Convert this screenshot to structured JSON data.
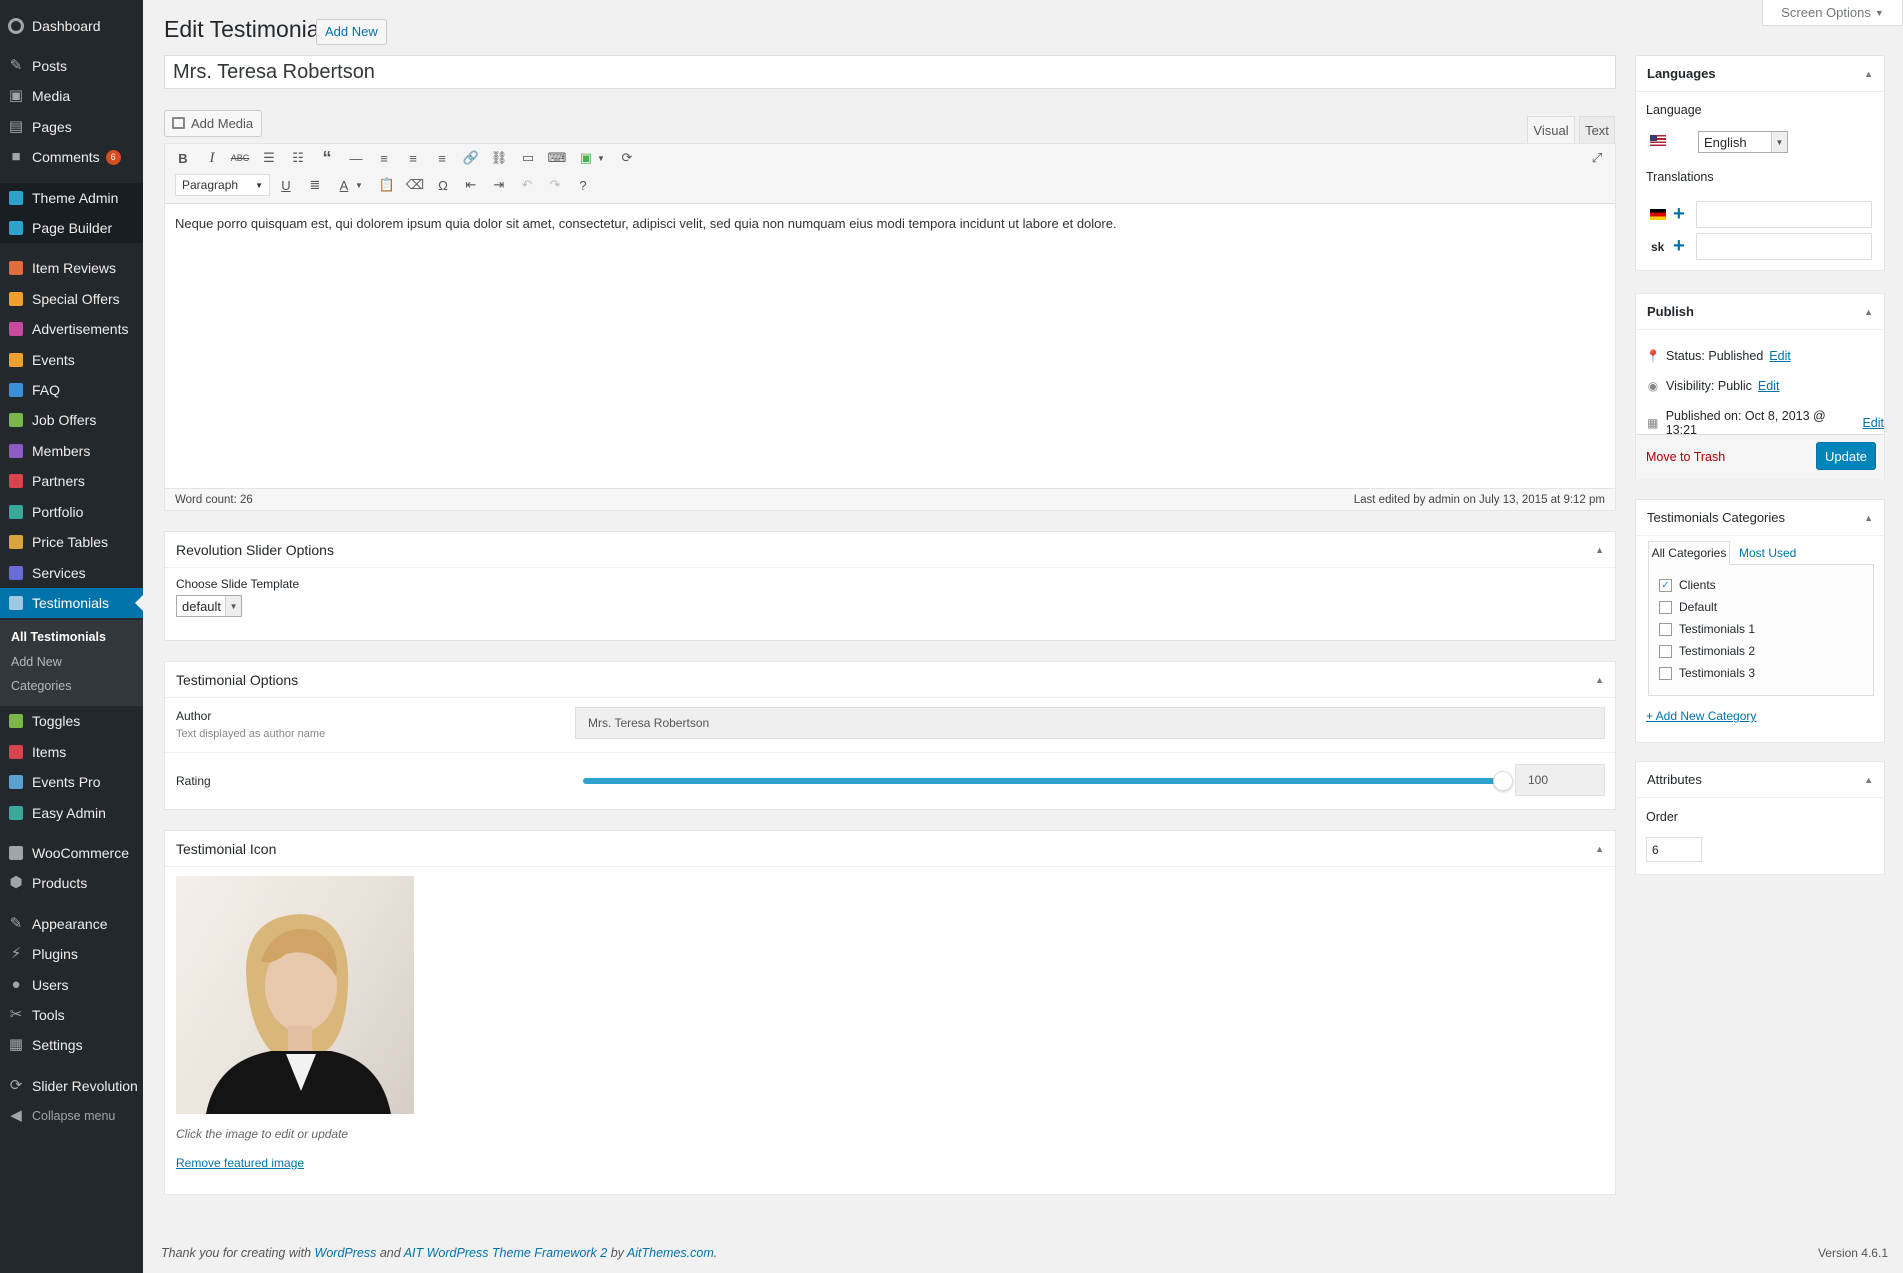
{
  "sidebar": {
    "items": [
      {
        "label": "Dashboard",
        "icon": "dashboard-icon"
      },
      {
        "label": "Posts",
        "icon": "pin-icon"
      },
      {
        "label": "Media",
        "icon": "media-icon"
      },
      {
        "label": "Pages",
        "icon": "pages-icon"
      },
      {
        "label": "Comments",
        "icon": "comment-icon",
        "badge": "6"
      },
      {
        "label": "Theme Admin",
        "icon": "theme-admin-icon"
      },
      {
        "label": "Page Builder",
        "icon": "page-builder-icon"
      },
      {
        "label": "Item Reviews",
        "icon": "item-reviews-icon"
      },
      {
        "label": "Special Offers",
        "icon": "special-offers-icon"
      },
      {
        "label": "Advertisements",
        "icon": "advertisements-icon"
      },
      {
        "label": "Events",
        "icon": "events-icon"
      },
      {
        "label": "FAQ",
        "icon": "faq-icon"
      },
      {
        "label": "Job Offers",
        "icon": "job-offers-icon"
      },
      {
        "label": "Members",
        "icon": "members-icon"
      },
      {
        "label": "Partners",
        "icon": "partners-icon"
      },
      {
        "label": "Portfolio",
        "icon": "portfolio-icon"
      },
      {
        "label": "Price Tables",
        "icon": "price-tables-icon"
      },
      {
        "label": "Services",
        "icon": "services-icon"
      },
      {
        "label": "Testimonials",
        "icon": "testimonials-icon"
      },
      {
        "label": "Toggles",
        "icon": "toggles-icon"
      },
      {
        "label": "Items",
        "icon": "items-icon"
      },
      {
        "label": "Events Pro",
        "icon": "events-pro-icon"
      },
      {
        "label": "Easy Admin",
        "icon": "easy-admin-icon"
      },
      {
        "label": "WooCommerce",
        "icon": "woocommerce-icon"
      },
      {
        "label": "Products",
        "icon": "products-icon"
      },
      {
        "label": "Appearance",
        "icon": "brush-icon"
      },
      {
        "label": "Plugins",
        "icon": "plug-icon"
      },
      {
        "label": "Users",
        "icon": "user-icon"
      },
      {
        "label": "Tools",
        "icon": "wrench-icon"
      },
      {
        "label": "Settings",
        "icon": "settings-icon"
      },
      {
        "label": "Slider Revolution",
        "icon": "refresh-icon"
      },
      {
        "label": "Collapse menu",
        "icon": "collapse-icon"
      }
    ],
    "submenu": [
      "All Testimonials",
      "Add New",
      "Categories"
    ]
  },
  "header": {
    "title": "Edit Testimonial",
    "add_new": "Add New",
    "screen_options": "Screen Options"
  },
  "post": {
    "title": "Mrs. Teresa Robertson",
    "add_media": "Add Media",
    "tab_visual": "Visual",
    "tab_text": "Text",
    "format": "Paragraph",
    "content": "Neque porro quisquam est, qui dolorem ipsum quia dolor sit amet, consectetur, adipisci velit, sed quia non numquam eius modi tempora incidunt ut labore et dolore.",
    "word_count": "Word count: 26",
    "last_edited": "Last edited by admin on July 13, 2015 at 9:12 pm"
  },
  "revslider": {
    "title": "Revolution Slider Options",
    "label": "Choose Slide Template",
    "value": "default"
  },
  "testimonial_options": {
    "title": "Testimonial Options",
    "author_label": "Author",
    "author_desc": "Text displayed as author name",
    "author_value": "Mrs. Teresa Robertson",
    "rating_label": "Rating",
    "rating_value": "100",
    "rating_fraction": 1.0
  },
  "testimonial_icon": {
    "title": "Testimonial Icon",
    "hint": "Click the image to edit or update",
    "remove": "Remove featured image"
  },
  "languages": {
    "title": "Languages",
    "language_label": "Language",
    "language_value": "English",
    "translations_label": "Translations",
    "sk_label": "sk"
  },
  "publish": {
    "title": "Publish",
    "status": "Status: Published",
    "visibility": "Visibility: Public",
    "published_on": "Published on: Oct 8, 2013 @ 13:21",
    "edit": "Edit",
    "trash": "Move to Trash",
    "update": "Update"
  },
  "categories": {
    "title": "Testimonials Categories",
    "tab_all": "All Categories",
    "tab_most": "Most Used",
    "items": [
      {
        "label": "Clients",
        "checked": true
      },
      {
        "label": "Default",
        "checked": false
      },
      {
        "label": "Testimonials 1",
        "checked": false
      },
      {
        "label": "Testimonials 2",
        "checked": false
      },
      {
        "label": "Testimonials 3",
        "checked": false
      }
    ],
    "add_new": "+ Add New Category"
  },
  "attributes": {
    "title": "Attributes",
    "order_label": "Order",
    "order_value": "6"
  },
  "footer": {
    "thanks_pre": "Thank you for creating with ",
    "wordpress": "WordPress",
    "and": " and ",
    "ait": "AIT WordPress Theme Framework 2",
    "by": " by ",
    "aitthemes": "AitThemes.com",
    "dot": ".",
    "version": "Version 4.6.1"
  },
  "colors": {
    "sidebar_bg": "#23282d",
    "active": "#0073aa",
    "link": "#0073aa",
    "update": "#0085ba",
    "trash": "#a00",
    "slider": "#2ea2cc"
  }
}
